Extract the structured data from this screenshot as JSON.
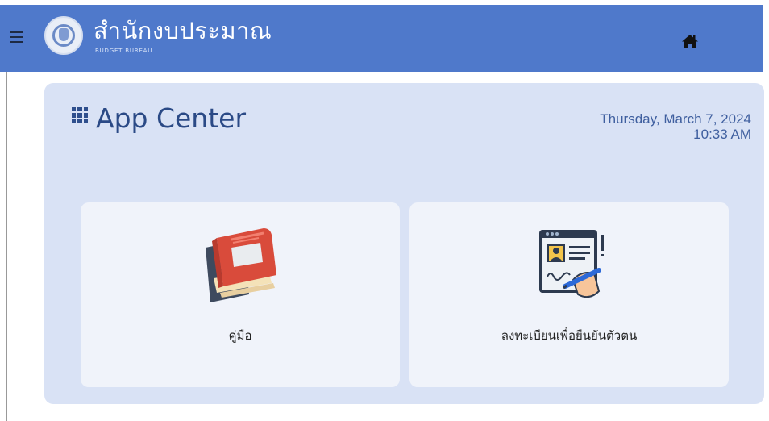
{
  "header": {
    "title": "สำนักงบประมาณ",
    "subtitle": "BUDGET BUREAU",
    "menu_icon": "hamburger-menu-icon",
    "home_icon": "home-icon",
    "colors": {
      "bar": "#4f79cb"
    }
  },
  "app_center": {
    "title": "App Center",
    "icon": "grid-icon",
    "date": "Thursday, March 7, 2024",
    "time": "10:33 AM"
  },
  "apps": [
    {
      "label": "คู่มือ",
      "icon": "book-icon"
    },
    {
      "label": "ลงทะเบียนเพื่อยืนยันตัวตน",
      "icon": "id-registration-icon"
    }
  ]
}
